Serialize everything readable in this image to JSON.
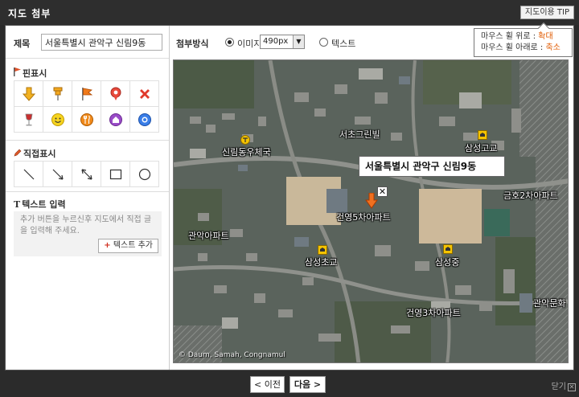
{
  "window": {
    "title": "지도 첨부",
    "tip_button": "지도이용 TIP"
  },
  "tooltip": {
    "line1_prefix": "마우스 휠 위로 : ",
    "line1_action": "확대",
    "line2_prefix": "마우스 휠 아래로 : ",
    "line2_action": "축소"
  },
  "address": {
    "label": "제목",
    "value": "서울특별시 관악구 신림9동"
  },
  "pin_section": {
    "title": "핀표시",
    "icons": [
      "arrow-down-icon",
      "pushpin-icon",
      "flag-icon",
      "location-pin-icon",
      "x-mark-icon",
      "wine-glass-icon",
      "smiley-icon",
      "restaurant-icon",
      "home-icon",
      "globe-icon"
    ]
  },
  "draw_section": {
    "title": "직접표시",
    "tools": [
      "line-icon",
      "arrow-line-icon",
      "double-arrow-icon",
      "rectangle-icon",
      "circle-icon"
    ]
  },
  "text_section": {
    "title": "텍스트 입력",
    "help": "추가 버튼을 누르신후 지도에서 직접 글을 입력해 주세요.",
    "add_button": "텍스트 추가"
  },
  "attach": {
    "label": "첨부방식",
    "image_label": "이미지",
    "size_value": "490px",
    "text_label": "텍스트",
    "selected": "image"
  },
  "map": {
    "callout": "서울특별시 관악구 신림9동",
    "close_symbol": "✕",
    "copyright": "© Daum, Samah, Congnamul",
    "labels": [
      {
        "text": "신림동우체국"
      },
      {
        "text": "서초그린빌"
      },
      {
        "text": "삼성고교"
      },
      {
        "text": "금호2차아파트"
      },
      {
        "text": "건영5차아파트"
      },
      {
        "text": "관악아파트"
      },
      {
        "text": "삼성초교"
      },
      {
        "text": "삼성중"
      },
      {
        "text": "건영3차아파트"
      },
      {
        "text": "관악문화"
      }
    ]
  },
  "nav": {
    "prev": "< 이전",
    "next": "다음 >",
    "close": "닫기"
  },
  "colors": {
    "accent_orange": "#e05a00",
    "titlebar": "#2e2e2e"
  }
}
